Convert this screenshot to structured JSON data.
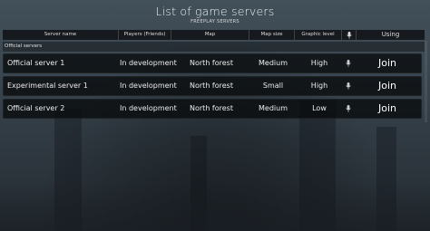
{
  "header": {
    "title": "List of game servers",
    "subtitle": "FREEPLAY SERVERS"
  },
  "columns": {
    "server_name": "Server name",
    "players": "Players (Friends)",
    "map": "Map",
    "map_size": "Map size",
    "graphic_level": "Graphic level",
    "voice_icon": "microphone-icon",
    "using": "Using"
  },
  "group": {
    "label": "Official servers"
  },
  "servers": [
    {
      "name": "Official server 1",
      "players": "In development",
      "map": "North forest",
      "map_size": "Medium",
      "graphic": "High",
      "action": "Join"
    },
    {
      "name": "Experimental server 1",
      "players": "In development",
      "map": "North forest",
      "map_size": "Small",
      "graphic": "High",
      "action": "Join"
    },
    {
      "name": "Official server 2",
      "players": "In development",
      "map": "North forest",
      "map_size": "Medium",
      "graphic": "Low",
      "action": "Join"
    }
  ]
}
